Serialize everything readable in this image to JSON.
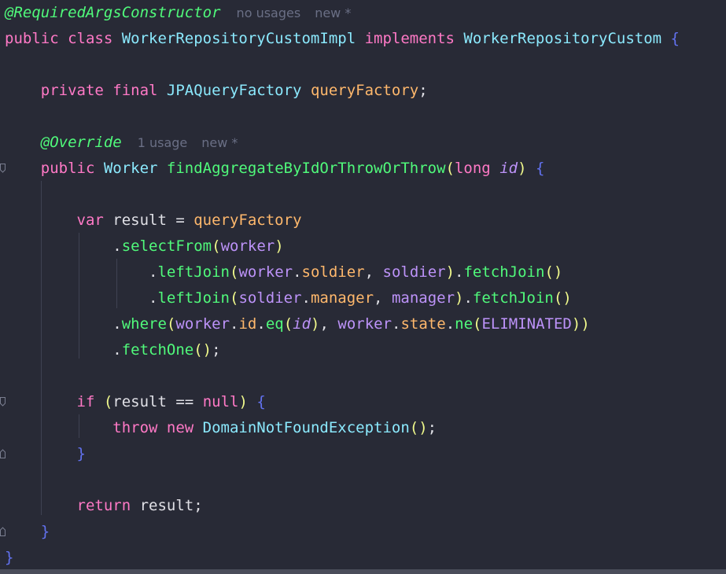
{
  "colors": {
    "background": "#282a36",
    "keyword": "#ff79c6",
    "type": "#8be9fd",
    "method": "#50fa7b",
    "field": "#ffb86c",
    "variable": "#bd93f9",
    "text": "#e0e0e6",
    "annotation": "#50fa7b",
    "paren": "#f1fa8c",
    "brace": "#6272f0",
    "hint": "#6a6f85"
  },
  "code": {
    "lines": [
      {
        "tokens": [
          {
            "text": "@RequiredArgsConstructor",
            "cls": "annotation",
            "italic": true
          },
          {
            "text": "no usages",
            "cls": "hint"
          },
          {
            "text": "new *",
            "cls": "hint"
          }
        ]
      },
      {
        "tokens": [
          {
            "text": "public class ",
            "cls": "keyword"
          },
          {
            "text": "WorkerRepositoryCustomImpl ",
            "cls": "type"
          },
          {
            "text": "implements ",
            "cls": "keyword"
          },
          {
            "text": "WorkerRepositoryCustom ",
            "cls": "type"
          },
          {
            "text": "{",
            "cls": "brace"
          }
        ]
      },
      {
        "tokens": []
      },
      {
        "tokens": [
          {
            "text": "    private final ",
            "cls": "keyword"
          },
          {
            "text": "JPAQueryFactory ",
            "cls": "type"
          },
          {
            "text": "queryFactory",
            "cls": "field"
          },
          {
            "text": ";",
            "cls": "text"
          }
        ]
      },
      {
        "tokens": []
      },
      {
        "tokens": [
          {
            "text": "    @Override",
            "cls": "annotation",
            "italic": true
          },
          {
            "text": "1 usage",
            "cls": "hint"
          },
          {
            "text": "new *",
            "cls": "hint"
          }
        ]
      },
      {
        "tokens": [
          {
            "text": "    public ",
            "cls": "keyword"
          },
          {
            "text": "Worker ",
            "cls": "type"
          },
          {
            "text": "findAggregateByIdOrThrowOrThrow",
            "cls": "method"
          },
          {
            "text": "(",
            "cls": "paren"
          },
          {
            "text": "long ",
            "cls": "keyword"
          },
          {
            "text": "id",
            "cls": "variable",
            "italic": true
          },
          {
            "text": ") ",
            "cls": "paren"
          },
          {
            "text": "{",
            "cls": "brace"
          }
        ]
      },
      {
        "tokens": []
      },
      {
        "tokens": [
          {
            "text": "        var ",
            "cls": "keyword"
          },
          {
            "text": "result = ",
            "cls": "text"
          },
          {
            "text": "queryFactory",
            "cls": "field"
          }
        ]
      },
      {
        "tokens": [
          {
            "text": "            .",
            "cls": "text"
          },
          {
            "text": "selectFrom",
            "cls": "method"
          },
          {
            "text": "(",
            "cls": "paren"
          },
          {
            "text": "worker",
            "cls": "variable"
          },
          {
            "text": ")",
            "cls": "paren"
          }
        ]
      },
      {
        "tokens": [
          {
            "text": "                .",
            "cls": "text"
          },
          {
            "text": "leftJoin",
            "cls": "method"
          },
          {
            "text": "(",
            "cls": "paren"
          },
          {
            "text": "worker",
            "cls": "variable"
          },
          {
            "text": ".",
            "cls": "text"
          },
          {
            "text": "soldier",
            "cls": "field"
          },
          {
            "text": ", ",
            "cls": "text"
          },
          {
            "text": "soldier",
            "cls": "variable"
          },
          {
            "text": ")",
            "cls": "paren"
          },
          {
            "text": ".",
            "cls": "text"
          },
          {
            "text": "fetchJoin",
            "cls": "method"
          },
          {
            "text": "()",
            "cls": "paren"
          }
        ]
      },
      {
        "tokens": [
          {
            "text": "                .",
            "cls": "text"
          },
          {
            "text": "leftJoin",
            "cls": "method"
          },
          {
            "text": "(",
            "cls": "paren"
          },
          {
            "text": "soldier",
            "cls": "variable"
          },
          {
            "text": ".",
            "cls": "text"
          },
          {
            "text": "manager",
            "cls": "field"
          },
          {
            "text": ", ",
            "cls": "text"
          },
          {
            "text": "manager",
            "cls": "variable"
          },
          {
            "text": ")",
            "cls": "paren"
          },
          {
            "text": ".",
            "cls": "text"
          },
          {
            "text": "fetchJoin",
            "cls": "method"
          },
          {
            "text": "()",
            "cls": "paren"
          }
        ]
      },
      {
        "tokens": [
          {
            "text": "            .",
            "cls": "text"
          },
          {
            "text": "where",
            "cls": "method"
          },
          {
            "text": "(",
            "cls": "paren"
          },
          {
            "text": "worker",
            "cls": "variable"
          },
          {
            "text": ".",
            "cls": "text"
          },
          {
            "text": "id",
            "cls": "field"
          },
          {
            "text": ".",
            "cls": "text"
          },
          {
            "text": "eq",
            "cls": "method"
          },
          {
            "text": "(",
            "cls": "paren"
          },
          {
            "text": "id",
            "cls": "variable",
            "italic": true
          },
          {
            "text": ")",
            "cls": "paren"
          },
          {
            "text": ", ",
            "cls": "text"
          },
          {
            "text": "worker",
            "cls": "variable"
          },
          {
            "text": ".",
            "cls": "text"
          },
          {
            "text": "state",
            "cls": "field"
          },
          {
            "text": ".",
            "cls": "text"
          },
          {
            "text": "ne",
            "cls": "method"
          },
          {
            "text": "(",
            "cls": "paren"
          },
          {
            "text": "ELIMINATED",
            "cls": "variable"
          },
          {
            "text": "))",
            "cls": "paren"
          }
        ]
      },
      {
        "tokens": [
          {
            "text": "            .",
            "cls": "text"
          },
          {
            "text": "fetchOne",
            "cls": "method"
          },
          {
            "text": "()",
            "cls": "paren"
          },
          {
            "text": ";",
            "cls": "text"
          }
        ]
      },
      {
        "tokens": []
      },
      {
        "tokens": [
          {
            "text": "        if ",
            "cls": "keyword"
          },
          {
            "text": "(",
            "cls": "paren"
          },
          {
            "text": "result == ",
            "cls": "text"
          },
          {
            "text": "null",
            "cls": "keyword"
          },
          {
            "text": ") ",
            "cls": "paren"
          },
          {
            "text": "{",
            "cls": "brace"
          }
        ]
      },
      {
        "tokens": [
          {
            "text": "            throw new ",
            "cls": "keyword"
          },
          {
            "text": "DomainNotFoundException",
            "cls": "type"
          },
          {
            "text": "()",
            "cls": "paren"
          },
          {
            "text": ";",
            "cls": "text"
          }
        ]
      },
      {
        "tokens": [
          {
            "text": "        }",
            "cls": "brace"
          }
        ]
      },
      {
        "tokens": []
      },
      {
        "tokens": [
          {
            "text": "        return ",
            "cls": "keyword"
          },
          {
            "text": "result",
            "cls": "text"
          },
          {
            "text": ";",
            "cls": "text"
          }
        ]
      },
      {
        "tokens": [
          {
            "text": "    }",
            "cls": "brace"
          }
        ]
      },
      {
        "tokens": [
          {
            "text": "}",
            "cls": "brace"
          }
        ]
      }
    ]
  },
  "gutter_icons": [
    {
      "line": 6,
      "name": "fold-marker-icon"
    },
    {
      "line": 15,
      "name": "fold-marker-icon"
    },
    {
      "line": 17,
      "name": "fold-end-marker-icon"
    },
    {
      "line": 20,
      "name": "fold-end-marker-icon"
    }
  ]
}
